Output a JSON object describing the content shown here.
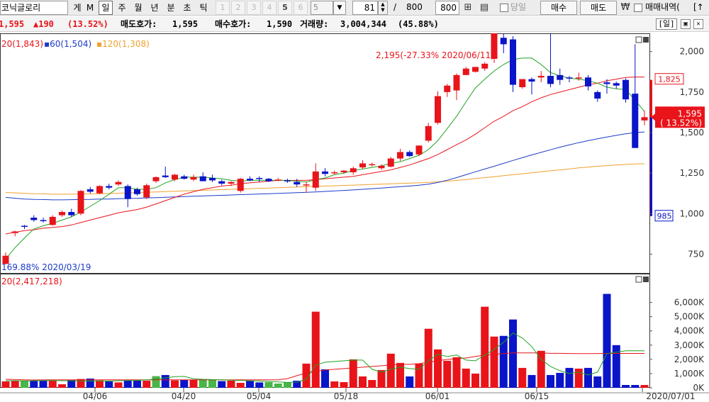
{
  "toolbar": {
    "stock_name": "코닉글로리",
    "left_buttons": [
      "게",
      "M"
    ],
    "period_buttons": [
      {
        "label": "일",
        "active": true
      },
      {
        "label": "주",
        "active": false
      },
      {
        "label": "월",
        "active": false
      },
      {
        "label": "년",
        "active": false
      },
      {
        "label": "분",
        "active": false
      },
      {
        "label": "초",
        "active": false
      },
      {
        "label": "틱",
        "active": false
      }
    ],
    "interval_buttons": [
      "1",
      "2",
      "3",
      "4",
      "5",
      "6"
    ],
    "interval_select": "5",
    "count_value": "81",
    "count_separator": "/",
    "count_total": "800",
    "count_input": "800",
    "today_label": "당일",
    "buy_label": "매수",
    "sell_label": "매도",
    "won_symbol": "₩",
    "trade_history_label": "매매내역(",
    "expand_glyph": "[↑"
  },
  "infobar": {
    "price": "1,595",
    "change": "▲190",
    "change_pct": "(13.52%)",
    "ask_label": "매도호가:",
    "ask_value": "1,595",
    "bid_label": "매수호가:",
    "bid_value": "1,590",
    "volume_label": "거래량:",
    "volume_value": "3,004,344",
    "volume_pct": "(45.88%)",
    "period_badge": "[일]"
  },
  "colors": {
    "up": "#e8141a",
    "down": "#0a14c8",
    "ma5": "#21a321",
    "ma20": "#e8141a",
    "ma60": "#1c3cc8",
    "ma120": "#f0a030",
    "vol_flat": "#48b648"
  },
  "chart_data": [
    {
      "type": "candlestick",
      "legend": [
        {
          "name": "20",
          "value": "(1,843)"
        },
        {
          "name": "60",
          "value": "(1,504)"
        },
        {
          "name": "120",
          "value": "(1,308)"
        }
      ],
      "y_ticks": [
        "750",
        "1,000",
        "1,250",
        "1,500",
        "1,750",
        "2,000"
      ],
      "ylim": [
        625,
        2375
      ],
      "high_annotation": "2,195(-27.33% 2020/06/11)",
      "low_annotation": "169.88% 2020/03/19",
      "current_price_label": "1,595",
      "current_pct_label": "( 13.52%)",
      "top_marker": "1,825",
      "bottom_marker": "985",
      "candles": [
        [
          690,
          760,
          685,
          740
        ],
        [
          880,
          895,
          860,
          890
        ],
        [
          925,
          930,
          905,
          920
        ],
        [
          975,
          990,
          950,
          960
        ],
        [
          960,
          975,
          945,
          955
        ],
        [
          930,
          990,
          925,
          980
        ],
        [
          990,
          1020,
          980,
          1010
        ],
        [
          1010,
          1030,
          980,
          990
        ],
        [
          1000,
          1145,
          990,
          1140
        ],
        [
          1150,
          1165,
          1125,
          1135
        ],
        [
          1125,
          1175,
          1120,
          1170
        ],
        [
          1170,
          1185,
          1150,
          1160
        ],
        [
          1180,
          1205,
          1170,
          1195
        ],
        [
          1170,
          1180,
          1040,
          1090
        ],
        [
          1150,
          1160,
          1110,
          1120
        ],
        [
          1100,
          1185,
          1090,
          1175
        ],
        [
          1200,
          1230,
          1190,
          1225
        ],
        [
          1235,
          1290,
          1220,
          1225
        ],
        [
          1210,
          1245,
          1200,
          1240
        ],
        [
          1230,
          1240,
          1210,
          1215
        ],
        [
          1210,
          1240,
          1200,
          1225
        ],
        [
          1230,
          1255,
          1200,
          1200
        ],
        [
          1220,
          1240,
          1195,
          1205
        ],
        [
          1200,
          1210,
          1175,
          1185
        ],
        [
          1185,
          1200,
          1170,
          1195
        ],
        [
          1140,
          1220,
          1130,
          1215
        ],
        [
          1215,
          1230,
          1200,
          1205
        ],
        [
          1220,
          1230,
          1195,
          1215
        ],
        [
          1215,
          1220,
          1195,
          1200
        ],
        [
          1205,
          1220,
          1200,
          1210
        ],
        [
          1205,
          1215,
          1190,
          1200
        ],
        [
          1195,
          1215,
          1165,
          1180
        ],
        [
          1180,
          1195,
          1130,
          1180
        ],
        [
          1160,
          1310,
          1140,
          1260
        ],
        [
          1260,
          1280,
          1230,
          1245
        ],
        [
          1255,
          1265,
          1240,
          1255
        ],
        [
          1255,
          1270,
          1245,
          1265
        ],
        [
          1255,
          1290,
          1240,
          1280
        ],
        [
          1285,
          1330,
          1275,
          1310
        ],
        [
          1300,
          1315,
          1290,
          1305
        ],
        [
          1280,
          1305,
          1270,
          1295
        ],
        [
          1290,
          1350,
          1285,
          1340
        ],
        [
          1340,
          1400,
          1325,
          1380
        ],
        [
          1380,
          1390,
          1350,
          1355
        ],
        [
          1365,
          1420,
          1355,
          1420
        ],
        [
          1450,
          1560,
          1440,
          1540
        ],
        [
          1560,
          1755,
          1550,
          1725
        ],
        [
          1750,
          1800,
          1720,
          1790
        ],
        [
          1760,
          1865,
          1700,
          1855
        ],
        [
          1855,
          1905,
          1855,
          1895
        ],
        [
          1875,
          1905,
          1870,
          1905
        ],
        [
          1895,
          1935,
          1880,
          1925
        ],
        [
          1955,
          2195,
          1930,
          2145
        ],
        [
          2085,
          2115,
          1990,
          2045
        ],
        [
          2075,
          2095,
          1750,
          1795
        ],
        [
          1780,
          1830,
          1770,
          1830
        ],
        [
          1830,
          1840,
          1735,
          1815
        ],
        [
          1840,
          1880,
          1810,
          1850
        ],
        [
          1850,
          2140,
          1780,
          1800
        ],
        [
          1855,
          1895,
          1795,
          1825
        ],
        [
          1840,
          1850,
          1810,
          1835
        ],
        [
          1840,
          1870,
          1820,
          1840
        ],
        [
          1840,
          1855,
          1760,
          1785
        ],
        [
          1750,
          1760,
          1690,
          1710
        ],
        [
          1810,
          1830,
          1740,
          1800
        ],
        [
          1805,
          1815,
          1770,
          1790
        ],
        [
          1825,
          1835,
          1685,
          1705
        ],
        [
          1740,
          2045,
          1410,
          1405
        ],
        [
          1575,
          1635,
          1545,
          1595
        ]
      ],
      "ma5": [
        720,
        790,
        850,
        905,
        925,
        940,
        960,
        980,
        1010,
        1045,
        1080,
        1120,
        1160,
        1160,
        1150,
        1150,
        1160,
        1190,
        1210,
        1225,
        1225,
        1225,
        1220,
        1215,
        1205,
        1200,
        1205,
        1205,
        1205,
        1205,
        1205,
        1200,
        1195,
        1210,
        1220,
        1240,
        1250,
        1265,
        1275,
        1285,
        1295,
        1310,
        1320,
        1340,
        1360,
        1395,
        1450,
        1525,
        1600,
        1690,
        1775,
        1830,
        1880,
        1920,
        1950,
        1960,
        1960,
        1920,
        1870,
        1850,
        1835,
        1830,
        1820,
        1805,
        1780,
        1770,
        1765,
        1700,
        1630
      ],
      "ma20": [
        875,
        885,
        895,
        900,
        910,
        915,
        920,
        930,
        945,
        960,
        975,
        990,
        1005,
        1015,
        1025,
        1040,
        1060,
        1080,
        1100,
        1120,
        1135,
        1150,
        1160,
        1170,
        1175,
        1185,
        1190,
        1195,
        1200,
        1205,
        1205,
        1205,
        1205,
        1210,
        1215,
        1220,
        1225,
        1230,
        1240,
        1250,
        1260,
        1270,
        1285,
        1300,
        1320,
        1340,
        1365,
        1395,
        1425,
        1455,
        1490,
        1530,
        1570,
        1600,
        1635,
        1660,
        1690,
        1715,
        1735,
        1750,
        1765,
        1780,
        1795,
        1805,
        1820,
        1830,
        1840,
        1843,
        1843
      ],
      "ma60": [
        1100,
        1095,
        1090,
        1088,
        1087,
        1085,
        1085,
        1086,
        1087,
        1088,
        1090,
        1090,
        1092,
        1093,
        1095,
        1097,
        1099,
        1101,
        1103,
        1105,
        1107,
        1109,
        1111,
        1113,
        1115,
        1117,
        1119,
        1121,
        1123,
        1125,
        1127,
        1129,
        1131,
        1134,
        1137,
        1140,
        1143,
        1146,
        1150,
        1154,
        1158,
        1162,
        1166,
        1170,
        1175,
        1182,
        1192,
        1206,
        1222,
        1240,
        1258,
        1275,
        1292,
        1310,
        1328,
        1345,
        1362,
        1378,
        1394,
        1410,
        1424,
        1438,
        1450,
        1462,
        1473,
        1483,
        1492,
        1500,
        1504
      ],
      "ma120": [
        1130,
        1128,
        1125,
        1123,
        1122,
        1120,
        1120,
        1120,
        1121,
        1122,
        1123,
        1124,
        1126,
        1128,
        1130,
        1132,
        1134,
        1136,
        1138,
        1140,
        1142,
        1144,
        1146,
        1148,
        1150,
        1152,
        1154,
        1156,
        1158,
        1160,
        1162,
        1164,
        1166,
        1168,
        1170,
        1172,
        1174,
        1176,
        1178,
        1180,
        1182,
        1184,
        1186,
        1188,
        1190,
        1193,
        1196,
        1200,
        1205,
        1210,
        1216,
        1222,
        1228,
        1234,
        1240,
        1246,
        1252,
        1258,
        1264,
        1270,
        1276,
        1282,
        1287,
        1292,
        1296,
        1300,
        1303,
        1306,
        1308
      ]
    },
    {
      "type": "bar",
      "legend": [
        {
          "name": "20",
          "value": "(2,417,218)"
        }
      ],
      "y_ticks": [
        "0K",
        "1,000K",
        "2,000K",
        "3,000K",
        "4,000K",
        "5,000K",
        "6,000K"
      ],
      "ylim": [
        0,
        7000
      ],
      "x_labels": [
        "04/06",
        "04/20",
        "05/04",
        "05/18",
        "06/01",
        "06/15",
        "2020/07/01"
      ],
      "volumes": [
        450,
        500,
        500,
        480,
        520,
        520,
        250,
        560,
        620,
        650,
        520,
        450,
        380,
        500,
        500,
        500,
        820,
        900,
        520,
        550,
        560,
        550,
        550,
        470,
        500,
        350,
        500,
        380,
        400,
        300,
        400,
        500,
        1700,
        5350,
        1300,
        450,
        400,
        2000,
        800,
        550,
        1250,
        2400,
        1750,
        800,
        1700,
        4150,
        2700,
        1900,
        2150,
        1350,
        1000,
        5700,
        3600,
        3650,
        4800,
        1400,
        900,
        2600,
        900,
        1050,
        1400,
        1350,
        1400,
        800,
        6600,
        3000,
        200,
        200,
        200
      ],
      "ma20_vol": [
        600,
        580,
        560,
        550,
        560,
        560,
        560,
        560,
        560,
        560,
        560,
        560,
        560,
        560,
        560,
        560,
        560,
        560,
        560,
        560,
        560,
        560,
        560,
        560,
        560,
        560,
        560,
        560,
        560,
        560,
        650,
        850,
        1050,
        1150,
        1250,
        1300,
        1350,
        1400,
        1450,
        1500,
        1550,
        1600,
        1650,
        1650,
        1700,
        1800,
        1900,
        2000,
        2050,
        2100,
        2200,
        2300,
        2350,
        2400,
        2450,
        2450,
        2450,
        2450,
        2420,
        2420,
        2410,
        2400,
        2400,
        2410,
        2415,
        2417,
        2417,
        2417,
        2417
      ],
      "ma5_vol": [
        500,
        500,
        490,
        500,
        510,
        520,
        500,
        500,
        480,
        480,
        480,
        480,
        500,
        520,
        520,
        560,
        620,
        700,
        780,
        800,
        640,
        600,
        580,
        560,
        540,
        520,
        500,
        480,
        450,
        420,
        380,
        400,
        600,
        1600,
        1800,
        1850,
        1900,
        1950,
        1950,
        1300,
        1100,
        1300,
        1450,
        1350,
        1300,
        1900,
        2350,
        2200,
        2300,
        1950,
        1900,
        2300,
        2700,
        3200,
        3850,
        3500,
        2900,
        2000,
        1500,
        1200,
        1000,
        1100,
        900,
        1100,
        2400,
        2500,
        2600,
        2600,
        2600
      ],
      "candle_colors_flat_idx": [
        2,
        16,
        21,
        22,
        28,
        29,
        30
      ]
    }
  ]
}
